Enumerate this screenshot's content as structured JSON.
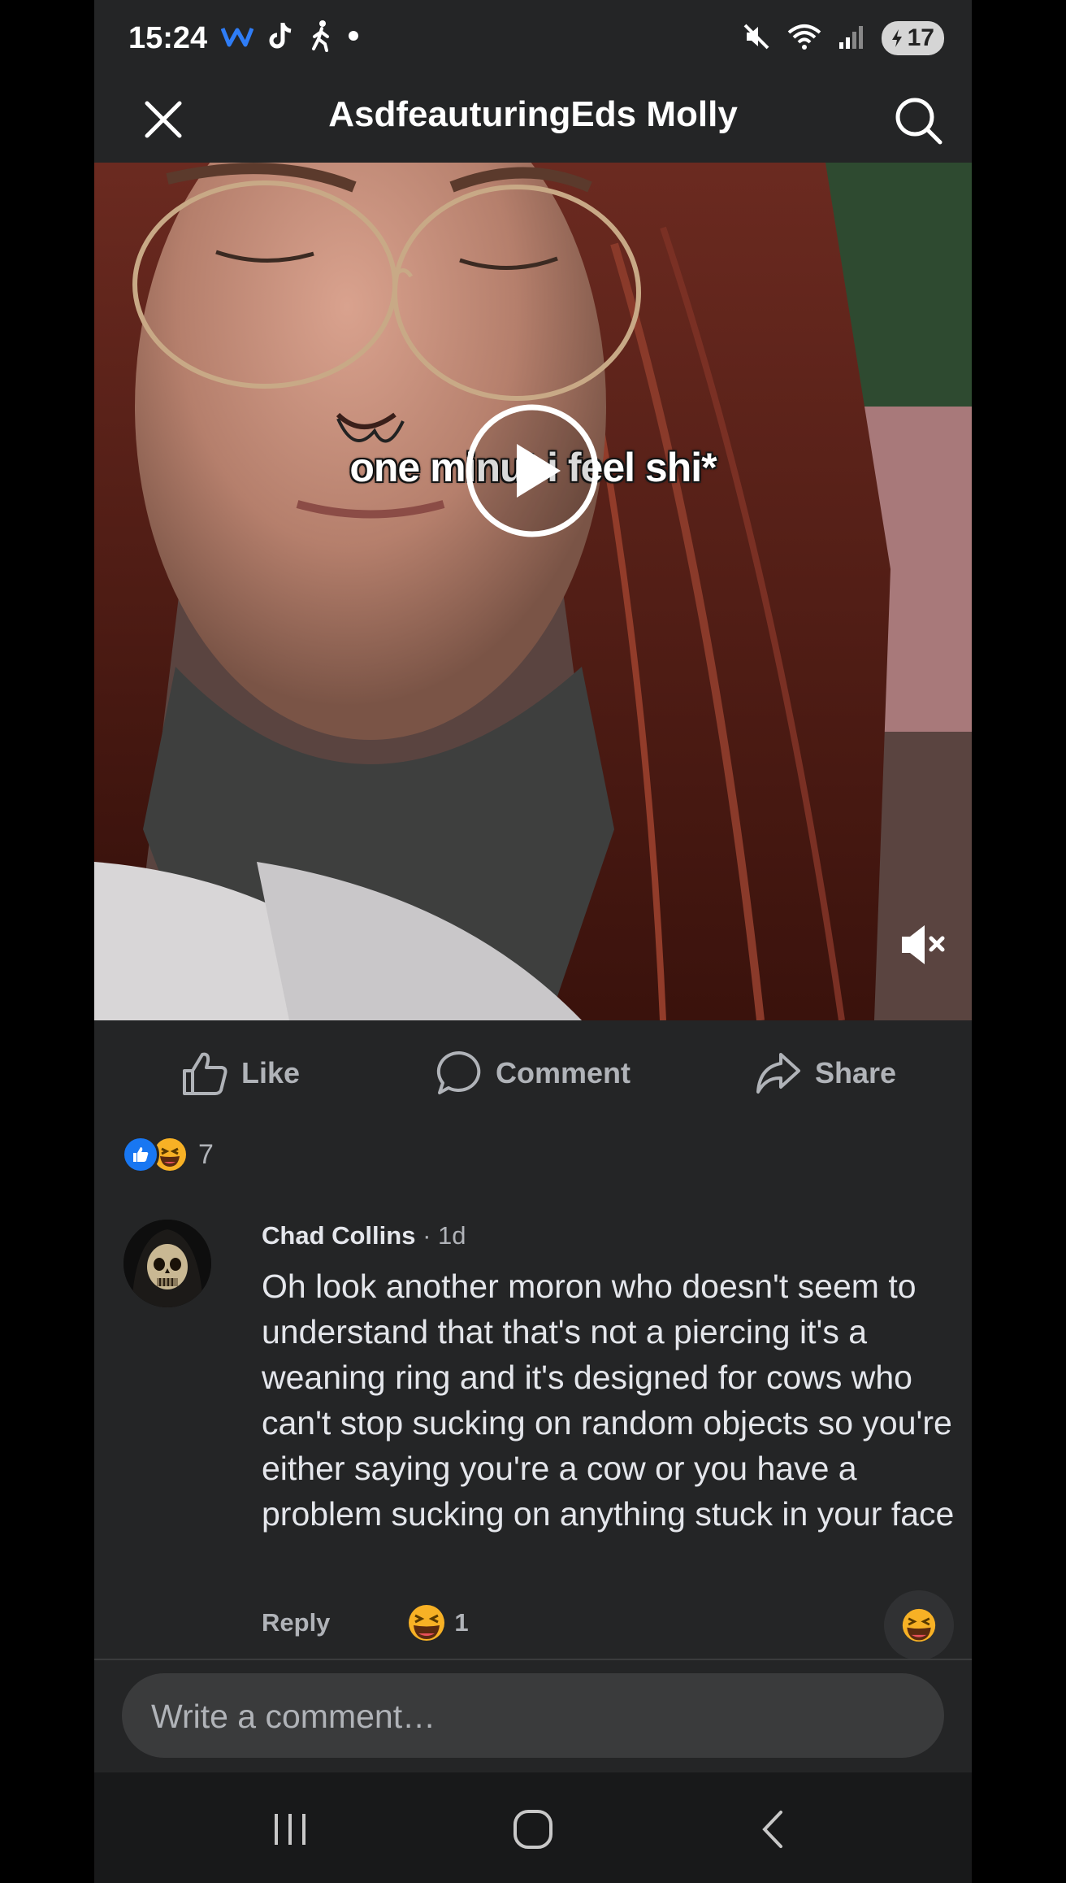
{
  "status_bar": {
    "time": "15:24",
    "battery": "17",
    "left_icons": [
      "w-app-icon",
      "tiktok-icon",
      "walking-icon",
      "dot-icon"
    ],
    "right_icons": [
      "mute-icon",
      "wifi-icon",
      "signal-icon",
      "battery-icon"
    ]
  },
  "header": {
    "title": "AsdfeauturingEds Molly",
    "close_icon": "close-icon",
    "search_icon": "search-icon"
  },
  "video": {
    "caption": "one minut  i feel shi*",
    "play_icon": "play-icon",
    "mute_icon": "volume-muted-icon"
  },
  "actions": [
    {
      "label": "Like",
      "icon": "thumbs-up-icon"
    },
    {
      "label": "Comment",
      "icon": "comment-bubble-icon"
    },
    {
      "label": "Share",
      "icon": "share-arrow-icon"
    }
  ],
  "reactions": {
    "types": [
      "like",
      "haha"
    ],
    "count": "7"
  },
  "comment": {
    "author": "Chad Collins",
    "time": " · 1d",
    "text": "Oh look another moron who doesn't seem to understand that that's not a piercing it's a weaning ring and it's designed for cows who can't stop sucking on random objects so you're either saying you're a cow or you have a problem sucking on anything stuck in your face",
    "reply_label": "Reply",
    "reaction_count": "1"
  },
  "composer": {
    "placeholder": "Write a comment…"
  },
  "nav_bar": [
    "recents-icon",
    "home-icon",
    "back-icon"
  ],
  "colors": {
    "background": "#242526",
    "text_primary": "#e4e6eb",
    "text_secondary": "#b0b3b8",
    "like_blue": "#1877f2",
    "haha_yellow": "#f7b125"
  }
}
